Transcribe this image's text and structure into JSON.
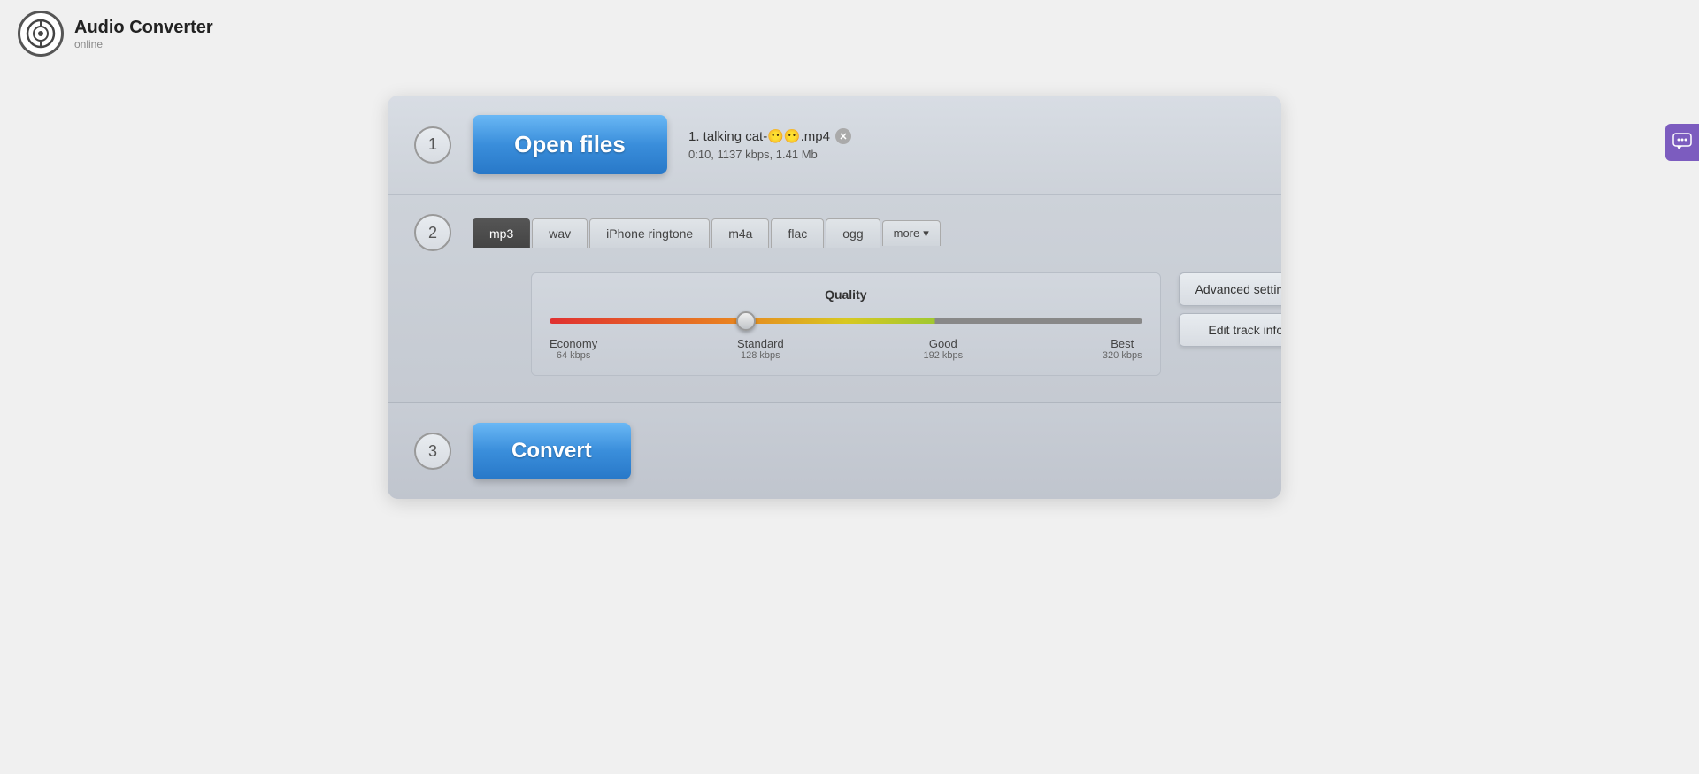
{
  "app": {
    "title": "Audio Converter",
    "subtitle": "online"
  },
  "header": {
    "logo_alt": "Audio Converter Logo"
  },
  "feedback": {
    "label": "Feedback"
  },
  "step1": {
    "number": "1",
    "open_files_label": "Open files",
    "file": {
      "name_prefix": "1. talking cat-",
      "emoji1": "😶",
      "emoji2": "😶",
      "extension": ".mp4",
      "meta": "0:10, 1137 kbps, 1.41 Mb"
    }
  },
  "step2": {
    "number": "2",
    "formats": [
      {
        "id": "mp3",
        "label": "mp3",
        "active": true
      },
      {
        "id": "wav",
        "label": "wav",
        "active": false
      },
      {
        "id": "iphone",
        "label": "iPhone ringtone",
        "active": false
      },
      {
        "id": "m4a",
        "label": "m4a",
        "active": false
      },
      {
        "id": "flac",
        "label": "flac",
        "active": false
      },
      {
        "id": "ogg",
        "label": "ogg",
        "active": false
      }
    ],
    "more_label": "more",
    "quality": {
      "title": "Quality",
      "labels": [
        {
          "name": "Economy",
          "kbps": "64 kbps"
        },
        {
          "name": "Standard",
          "kbps": "128 kbps"
        },
        {
          "name": "Good",
          "kbps": "192 kbps"
        },
        {
          "name": "Best",
          "kbps": "320 kbps"
        }
      ],
      "current_value": "Standard"
    },
    "advanced_settings_label": "Advanced settings",
    "edit_track_info_label": "Edit track info"
  },
  "step3": {
    "number": "3",
    "convert_label": "Convert"
  }
}
